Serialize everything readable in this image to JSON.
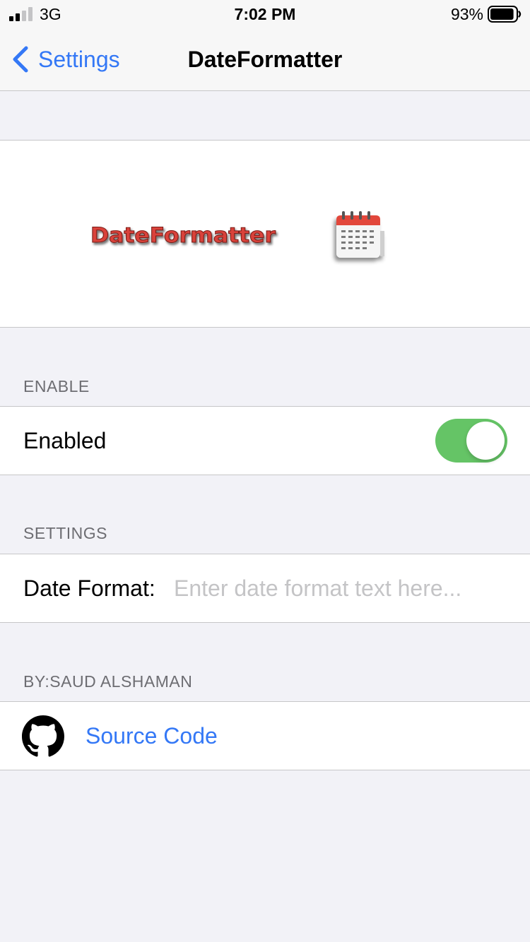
{
  "status_bar": {
    "carrier": "3G",
    "time": "7:02 PM",
    "battery_percent": "93%",
    "battery_level": 0.93,
    "signal_bars": 2
  },
  "nav": {
    "back_label": "Settings",
    "title": "DateFormatter"
  },
  "banner": {
    "logo_text": "DateFormatter",
    "icon": "calendar-icon"
  },
  "sections": {
    "enable": {
      "header": "ENABLE",
      "enabled_label": "Enabled",
      "enabled_value": true
    },
    "settings": {
      "header": "SETTINGS",
      "date_format_label": "Date Format:",
      "date_format_value": "",
      "date_format_placeholder": "Enter date format text here..."
    },
    "credits": {
      "header": "BY:SAUD ALSHAMAN",
      "source_code_label": "Source Code",
      "source_code_icon": "github-icon"
    }
  },
  "colors": {
    "accent": "#3478f6",
    "toggle_on": "#65c466",
    "background": "#f2f2f7",
    "logo_red": "#d9433a"
  }
}
